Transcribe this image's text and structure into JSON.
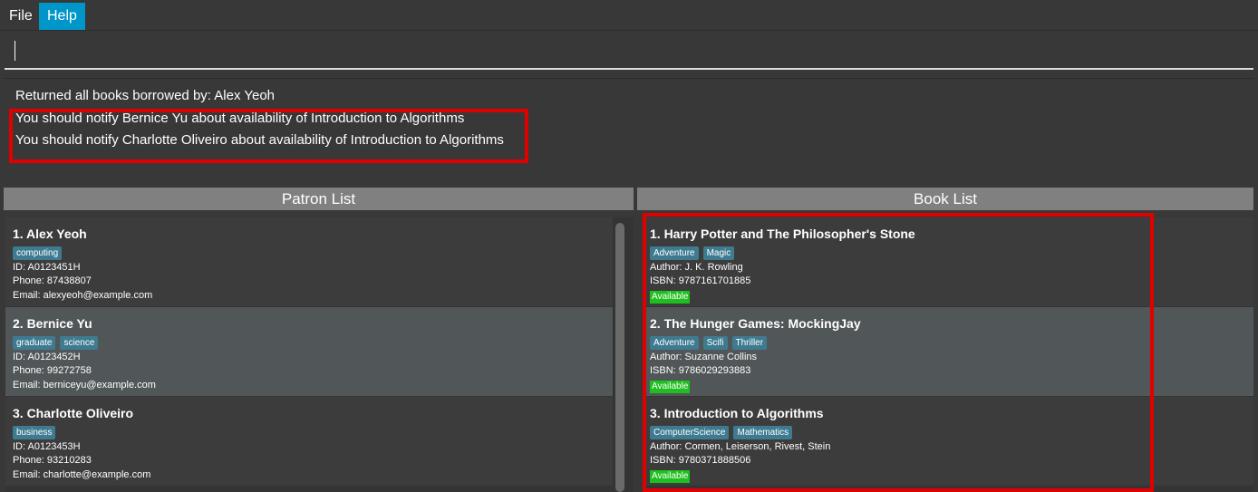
{
  "menu": {
    "file": "File",
    "help": "Help"
  },
  "command_box": {
    "value": ""
  },
  "result": {
    "lines": [
      "Returned all books borrowed by: Alex Yeoh",
      "You should notify Bernice Yu about availability of Introduction to Algorithms",
      "You should notify Charlotte Oliveiro about availability of Introduction to Algorithms"
    ]
  },
  "patron_list": {
    "header": "Patron List",
    "items": [
      {
        "title": "1.  Alex Yeoh",
        "tags": [
          "computing"
        ],
        "id": "ID: A0123451H",
        "phone": "Phone: 87438807",
        "email": "Email: alexyeoh@example.com"
      },
      {
        "title": "2.  Bernice Yu",
        "tags": [
          "graduate",
          "science"
        ],
        "id": "ID: A0123452H",
        "phone": "Phone: 99272758",
        "email": "Email: berniceyu@example.com"
      },
      {
        "title": "3.  Charlotte Oliveiro",
        "tags": [
          "business"
        ],
        "id": "ID: A0123453H",
        "phone": "Phone: 93210283",
        "email": "Email: charlotte@example.com"
      }
    ]
  },
  "book_list": {
    "header": "Book List",
    "items": [
      {
        "title": "1.  Harry Potter and The Philosopher's Stone",
        "tags": [
          "Adventure",
          "Magic"
        ],
        "author": "Author: J. K. Rowling",
        "isbn": "ISBN: 9787161701885",
        "status": "Available"
      },
      {
        "title": "2.  The Hunger Games: MockingJay",
        "tags": [
          "Adventure",
          "Scifi",
          "Thriller"
        ],
        "author": "Author: Suzanne Collins",
        "isbn": "ISBN: 9786029293883",
        "status": "Available"
      },
      {
        "title": "3.  Introduction to Algorithms",
        "tags": [
          "ComputerScience",
          "Mathematics"
        ],
        "author": "Author: Cormen, Leiserson, Rivest, Stein",
        "isbn": "ISBN: 9780371888506",
        "status": "Available"
      }
    ]
  },
  "colors": {
    "background": "#383838",
    "menu_highlight": "#0096c9",
    "tag": "#3e7b91",
    "available": "#1fbf1f",
    "highlight_box": "#e00000",
    "header": "#808080"
  }
}
